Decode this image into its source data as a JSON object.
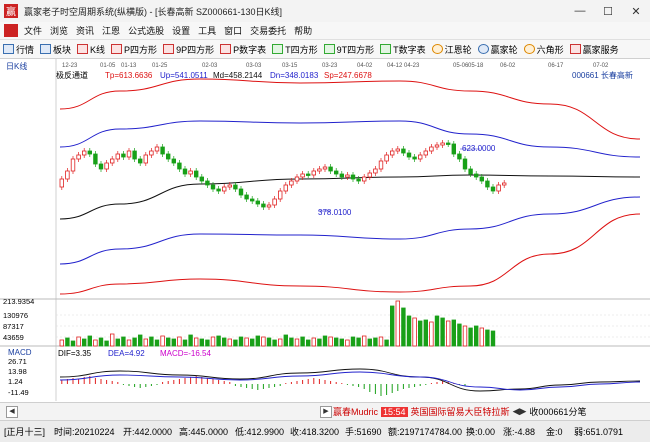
{
  "window": {
    "title": "赢家老子时空周期系统(纵横版) - [长春高新  SZ000661-130日K线]",
    "buttons": [
      "—",
      "☐",
      "✕"
    ]
  },
  "menu": {
    "items": [
      "文件",
      "浏览",
      "资讯",
      "江恩",
      "公式选股",
      "设置",
      "工具",
      "窗口",
      "交易委托",
      "帮助"
    ]
  },
  "toolbar": {
    "items": [
      {
        "label": "行情",
        "icon": "grid-icon"
      },
      {
        "label": "板块",
        "icon": "sector-icon"
      },
      {
        "label": "K线",
        "icon": "kline-icon"
      },
      {
        "label": "P四方形",
        "icon": "p-square-icon"
      },
      {
        "label": "9P四方形",
        "icon": "9p-square-icon"
      },
      {
        "label": "P数字表",
        "icon": "p-number-icon"
      },
      {
        "label": "T四方形",
        "icon": "t-square-icon"
      },
      {
        "label": "9T四方形",
        "icon": "9t-square-icon"
      },
      {
        "label": "T数字表",
        "icon": "t-number-icon"
      },
      {
        "label": "江恩轮",
        "icon": "gann-wheel-icon"
      },
      {
        "label": "赢家轮",
        "icon": "winner-wheel-icon"
      },
      {
        "label": "六角形",
        "icon": "hexagon-icon"
      },
      {
        "label": "赢家服务",
        "icon": "service-icon"
      }
    ]
  },
  "chart_header": {
    "period": "日K线",
    "indicator_name": "极反通道",
    "tp": "Tp=613.6636",
    "up": "Up=541.0511",
    "md": "Md=458.2144",
    "dn": "Dn=348.0183",
    "sp": "Sp=247.6678",
    "stock": "000661  长春高新"
  },
  "date_labels": [
    "12-23",
    "01-05",
    "01-13",
    "01-25",
    "02-03",
    "03-03",
    "03-15",
    "03-23",
    "04-02",
    "04-12",
    "04-23",
    "05-06",
    "05-18",
    "06-02",
    "06-17",
    "07-02"
  ],
  "annotations": {
    "high": "623.0000",
    "low": "378.0100"
  },
  "volume": {
    "top_label": "213.9354",
    "ticks": [
      "130976",
      "87317",
      "43659"
    ]
  },
  "macd": {
    "title": "MACD",
    "dif": "DIF=3.35",
    "dea": "DEA=4.92",
    "macd": "MACD=-16.54",
    "ticks": [
      "26.71",
      "13.98",
      "1.24",
      "-11.49"
    ]
  },
  "chart_data": [
    {
      "type": "candlestick",
      "title": "极反通道",
      "x": [
        "12-23",
        "01-05",
        "01-13",
        "01-25",
        "02-03",
        "03-03",
        "03-15",
        "03-23",
        "04-02",
        "04-12",
        "04-23",
        "05-06",
        "05-18",
        "06-02"
      ],
      "close": [
        415,
        470,
        455,
        470,
        500,
        440,
        400,
        430,
        470,
        450,
        440,
        500,
        590,
        460
      ],
      "bands": {
        "tp": 613.66,
        "up": 541.05,
        "md": 458.21,
        "dn": 348.02,
        "sp": 247.67
      },
      "annotations": [
        {
          "label": "623.0000",
          "at": "05-18"
        },
        {
          "label": "378.0100",
          "at": "03-15"
        }
      ]
    },
    {
      "type": "bar",
      "title": "volume",
      "x": [
        "12-23",
        "01-05",
        "01-13",
        "01-25",
        "02-03",
        "03-03",
        "03-15",
        "03-23",
        "04-02",
        "04-12",
        "04-23",
        "05-06",
        "05-18",
        "06-02"
      ],
      "values": [
        40000,
        50000,
        35000,
        45000,
        55000,
        40000,
        38000,
        36000,
        45000,
        42000,
        40000,
        60000,
        130976,
        80000
      ]
    },
    {
      "type": "line",
      "title": "MACD",
      "series": [
        {
          "name": "DIF",
          "last": 3.35
        },
        {
          "name": "DEA",
          "last": 4.92
        },
        {
          "name": "MACD",
          "last": -16.54
        }
      ]
    }
  ],
  "statusbar": {
    "ticker_left": "赢春Mudric",
    "ticker_time": "15:54",
    "ticker_news": "英国国际留易大臣特拉斯",
    "link": "收000661分笔"
  },
  "infobar": {
    "period": "[正月十三]",
    "time": "时间:20210224",
    "open": "开:442.0000",
    "high": "高:445.0000",
    "low": "低:412.9900",
    "close": "收:418.3200",
    "hand": "手:51690",
    "amount": "额:2197174784.00",
    "turnover": "换:0.00",
    "change": "涨:-4.88",
    "coin": "金:0",
    "weak": "弱:651.0791"
  },
  "colors": {
    "up_candle": "#e02020",
    "down_candle": "#18a018",
    "top_band": "#d11",
    "mid_band": "#22c",
    "md_band": "#111",
    "axis_label": "#1a3fa0"
  }
}
